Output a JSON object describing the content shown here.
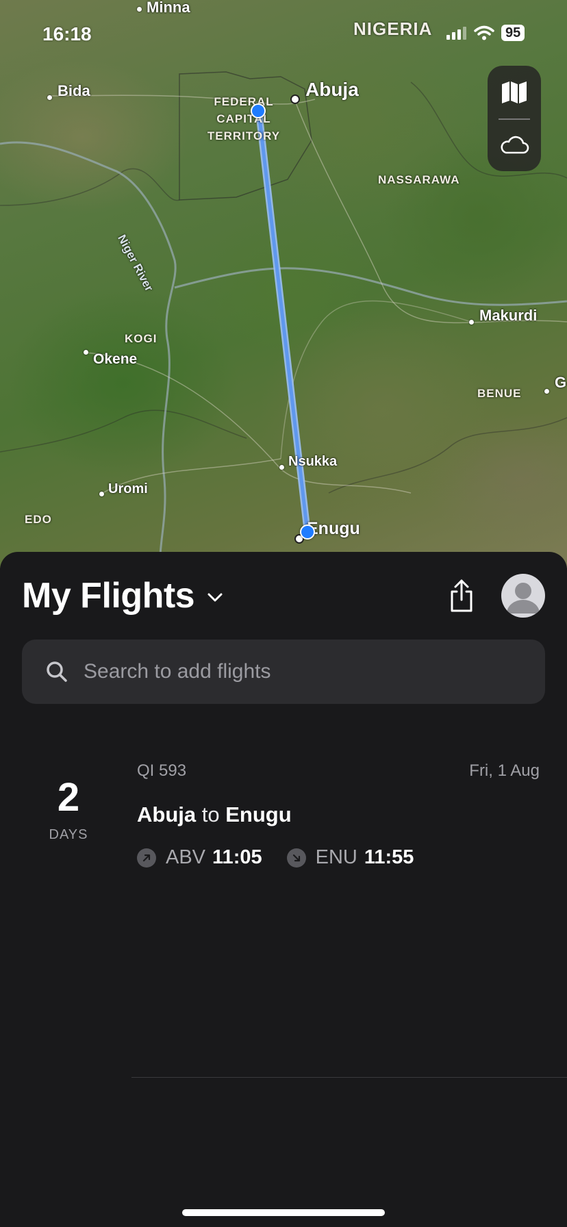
{
  "status_bar": {
    "time": "16:18",
    "country": "NIGERIA",
    "battery": "95"
  },
  "map": {
    "labels": {
      "minna": "Minna",
      "bida": "Bida",
      "abuja": "Abuja",
      "fct_line1": "FEDERAL",
      "fct_line2": "CAPITAL",
      "fct_line3": "TERRITORY",
      "nassarawa": "NASSARAWA",
      "niger_river": "Niger River",
      "kogi": "KOGI",
      "okene": "Okene",
      "makurdi": "Makurdi",
      "benue": "BENUE",
      "g_partial": "G",
      "nsukka": "Nsukka",
      "uromi": "Uromi",
      "edo": "EDO",
      "enugu": "Enugu"
    },
    "route_color": "#6aa0f0",
    "endpoint_color": "#1f7cff"
  },
  "sheet": {
    "title": "My Flights",
    "search_placeholder": "Search to add flights",
    "flights": [
      {
        "countdown_value": "2",
        "countdown_unit": "DAYS",
        "code": "QI 593",
        "date": "Fri, 1 Aug",
        "origin_city": "Abuja",
        "connector": "to",
        "destination_city": "Enugu",
        "departure_code": "ABV",
        "departure_time": "11:05",
        "arrival_code": "ENU",
        "arrival_time": "11:55"
      }
    ]
  }
}
